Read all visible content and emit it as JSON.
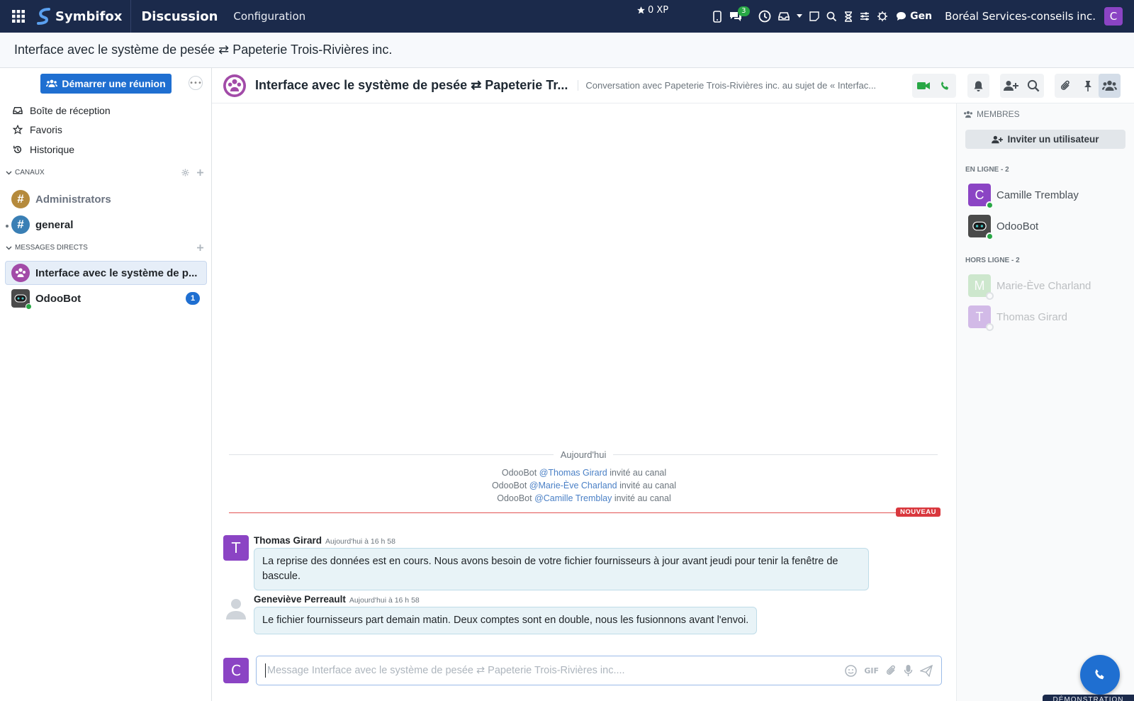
{
  "navbar": {
    "brand": "Symbifox",
    "app_title": "Discussion",
    "menu": [
      "Configuration"
    ],
    "xp": "0 XP",
    "messages_badge": "3",
    "gen_label": "Gen",
    "company": "Boréal Services-conseils inc.",
    "user_initial": "C"
  },
  "breadcrumb": {
    "title": "Interface avec le système de pesée ⇄ Papeterie Trois-Rivières inc."
  },
  "sidebar": {
    "start_meeting": "Démarrer une réunion",
    "nav": [
      {
        "label": "Boîte de réception",
        "icon": "inbox-icon"
      },
      {
        "label": "Favoris",
        "icon": "star-icon"
      },
      {
        "label": "Historique",
        "icon": "history-icon"
      }
    ],
    "channels_heading": "CANAUX",
    "channels": [
      {
        "name": "Administrators",
        "color": "#b58a3c"
      },
      {
        "name": "general",
        "color": "#3a7fb5"
      }
    ],
    "dm_heading": "MESSAGES DIRECTS",
    "dms": [
      {
        "name": "Interface avec le système de p...",
        "active": true
      },
      {
        "name": "OdooBot",
        "unread": "1"
      }
    ]
  },
  "thread": {
    "name": "Interface avec le système de pesée ⇄ Papeterie Tr...",
    "description": "Conversation avec Papeterie Trois-Rivières inc. au sujet de « Interfac..."
  },
  "messages": {
    "date_separator": "Aujourd'hui",
    "notifications": [
      {
        "actor": "OdooBot",
        "mention": "@Thomas Girard",
        "text": "invité au canal"
      },
      {
        "actor": "OdooBot",
        "mention": "@Marie-Ève Charland",
        "text": "invité au canal"
      },
      {
        "actor": "OdooBot",
        "mention": "@Camille Tremblay",
        "text": "invité au canal"
      }
    ],
    "new_label": "NOUVEAU",
    "items": [
      {
        "author": "Thomas Girard",
        "initial": "T",
        "time": "Aujourd'hui à 16 h 58",
        "body": "La reprise des données est en cours. Nous avons besoin de votre fichier fournisseurs à jour avant jeudi pour tenir la fenêtre de bascule."
      },
      {
        "author": "Geneviève Perreault",
        "time": "Aujourd'hui à 16 h 58",
        "body": "Le fichier fournisseurs part demain matin. Deux comptes sont en double, nous les fusionnons avant l'envoi."
      }
    ]
  },
  "composer": {
    "user_initial": "C",
    "placeholder": "Message Interface avec le système de pesée ⇄ Papeterie Trois-Rivières inc...."
  },
  "members": {
    "heading": "MEMBRES",
    "invite_label": "Inviter un utilisateur",
    "online_heading": "EN LIGNE - 2",
    "online": [
      {
        "name": "Camille Tremblay",
        "initial": "C",
        "color": "#8b44c4"
      },
      {
        "name": "OdooBot",
        "initial": "",
        "color": "#4a4a4a"
      }
    ],
    "offline_heading": "HORS LIGNE - 2",
    "offline": [
      {
        "name": "Marie-Ève Charland",
        "initial": "M",
        "color": "#7cc47a"
      },
      {
        "name": "Thomas Girard",
        "initial": "T",
        "color": "#8b44c4"
      }
    ]
  },
  "demo_label": "DÉMONSTRATION"
}
